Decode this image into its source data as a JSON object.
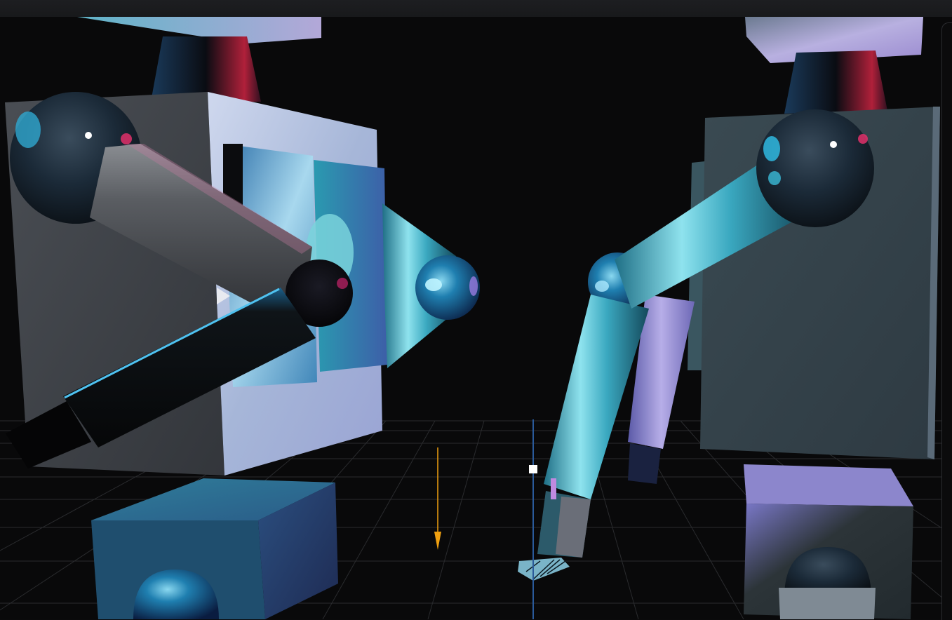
{
  "scene": {
    "background": "#09090a",
    "grid_color": "#2a2b2e",
    "accent_colors": {
      "cyan": "#3fc6d6",
      "lavender": "#b9b3e6",
      "magenta": "#e0306a",
      "orange_axis": "#f0a010",
      "blue_axis": "#2a5a9a"
    },
    "objects": [
      "left-robot-arm",
      "right-robot-arm",
      "robot-hand-gripper",
      "transform-gizmo",
      "floor-grid"
    ]
  }
}
